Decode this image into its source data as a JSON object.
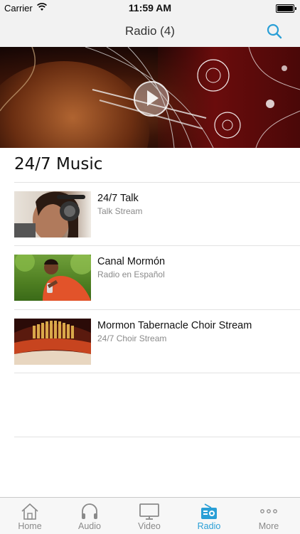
{
  "status_bar": {
    "carrier": "Carrier",
    "time": "11:59 AM"
  },
  "navbar": {
    "title": "Radio (4)"
  },
  "section": {
    "title": "24/7 Music"
  },
  "items": [
    {
      "title": "24/7 Talk",
      "subtitle": "Talk Stream"
    },
    {
      "title": "Canal Mormón",
      "subtitle": "Radio en Español"
    },
    {
      "title": "Mormon Tabernacle Choir Stream",
      "subtitle": "24/7 Choir Stream"
    }
  ],
  "tabs": [
    {
      "label": "Home",
      "icon": "home-icon"
    },
    {
      "label": "Audio",
      "icon": "headphones-icon"
    },
    {
      "label": "Video",
      "icon": "tv-icon"
    },
    {
      "label": "Radio",
      "icon": "radio-icon",
      "active": true
    },
    {
      "label": "More",
      "icon": "more-icon"
    }
  ],
  "colors": {
    "accent": "#2a9fd6",
    "inactive": "#8a8a8a",
    "bar": "#f7f7f7"
  }
}
